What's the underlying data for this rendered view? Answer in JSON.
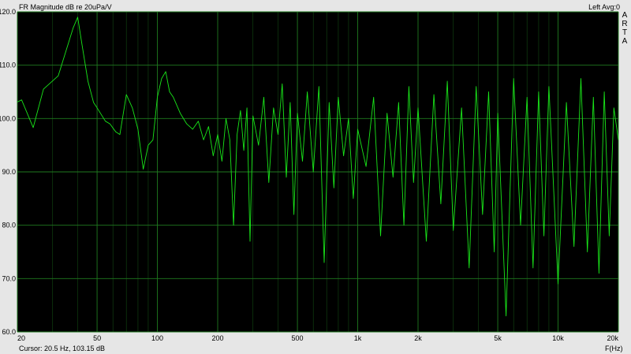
{
  "header": {
    "title": "FR Magnitude dB re 20uPa/V",
    "status": "Left  Avg:0"
  },
  "logo_letters": [
    "A",
    "R",
    "T",
    "A"
  ],
  "footer": {
    "cursor_label": "Cursor:",
    "cursor_value": "20.5 Hz, 103.15 dB",
    "x_unit": "F(Hz)"
  },
  "colors": {
    "background": "#000000",
    "grid": "#1f7a1f",
    "trace": "#19e619",
    "frame": "#e6e6e6"
  },
  "chart_data": {
    "type": "line",
    "title": "FR Magnitude dB re 20uPa/V",
    "xlabel": "F(Hz)",
    "ylabel": "",
    "xscale": "log",
    "xlim": [
      20,
      20000
    ],
    "ylim": [
      60,
      120
    ],
    "x_ticks": [
      20,
      50,
      100,
      200,
      500,
      1000,
      2000,
      5000,
      10000,
      20000
    ],
    "x_tick_labels": [
      "20",
      "50",
      "100",
      "200",
      "500",
      "1k",
      "2k",
      "5k",
      "10k",
      "20k"
    ],
    "y_ticks": [
      60,
      70,
      80,
      90,
      100,
      110,
      120
    ],
    "y_tick_labels": [
      "60.0",
      "70.0",
      "80.0",
      "90.0",
      "100.0",
      "110.0",
      "120.0"
    ],
    "grid": true,
    "series": [
      {
        "values_x": [
          20,
          21,
          24,
          27,
          32,
          38,
          40,
          42,
          45,
          48,
          50,
          55,
          58,
          62,
          65,
          70,
          75,
          80,
          85,
          90,
          95,
          100,
          105,
          110,
          115,
          120,
          130,
          140,
          150,
          160,
          170,
          180,
          190,
          200,
          210,
          220,
          230,
          240,
          250,
          260,
          270,
          280,
          290,
          300,
          320,
          340,
          360,
          380,
          400,
          420,
          440,
          460,
          480,
          500,
          530,
          560,
          600,
          640,
          680,
          720,
          760,
          800,
          850,
          900,
          950,
          1000,
          1100,
          1200,
          1300,
          1400,
          1500,
          1600,
          1700,
          1800,
          1900,
          2000,
          2200,
          2400,
          2600,
          2800,
          3000,
          3300,
          3600,
          3900,
          4200,
          4500,
          4800,
          5000,
          5500,
          6000,
          6500,
          7000,
          7500,
          8000,
          8500,
          9000,
          10000,
          11000,
          12000,
          13000,
          14000,
          15000,
          16000,
          17000,
          18000,
          19000,
          20000
        ],
        "values_y": [
          103.1,
          103.5,
          98.3,
          105.5,
          108.0,
          117.0,
          119.0,
          114.0,
          107.0,
          103.0,
          102.0,
          99.5,
          99.0,
          97.5,
          97.0,
          104.5,
          102.0,
          98.0,
          90.5,
          95.0,
          96.0,
          104.0,
          107.5,
          108.8,
          105.0,
          104.0,
          101.0,
          99.0,
          98.0,
          99.5,
          96.0,
          98.5,
          93.0,
          97.0,
          92.0,
          100.0,
          96.0,
          80.0,
          97.0,
          101.5,
          94.0,
          102.0,
          77.0,
          100.5,
          95.0,
          104.0,
          88.0,
          102.0,
          97.0,
          106.5,
          89.0,
          103.0,
          82.0,
          101.0,
          92.0,
          105.0,
          90.0,
          106.0,
          73.0,
          103.0,
          87.0,
          104.0,
          93.0,
          100.0,
          85.0,
          98.0,
          91.0,
          104.0,
          78.0,
          101.0,
          89.0,
          103.0,
          80.0,
          106.0,
          88.0,
          102.0,
          77.0,
          104.5,
          84.0,
          107.0,
          79.0,
          102.0,
          72.0,
          106.0,
          82.0,
          105.0,
          75.0,
          101.0,
          63.0,
          107.5,
          80.0,
          104.0,
          72.0,
          105.0,
          78.0,
          106.0,
          69.0,
          103.0,
          76.0,
          107.5,
          75.0,
          104.0,
          71.0,
          105.0,
          78.0,
          102.0,
          96.0
        ]
      }
    ]
  }
}
